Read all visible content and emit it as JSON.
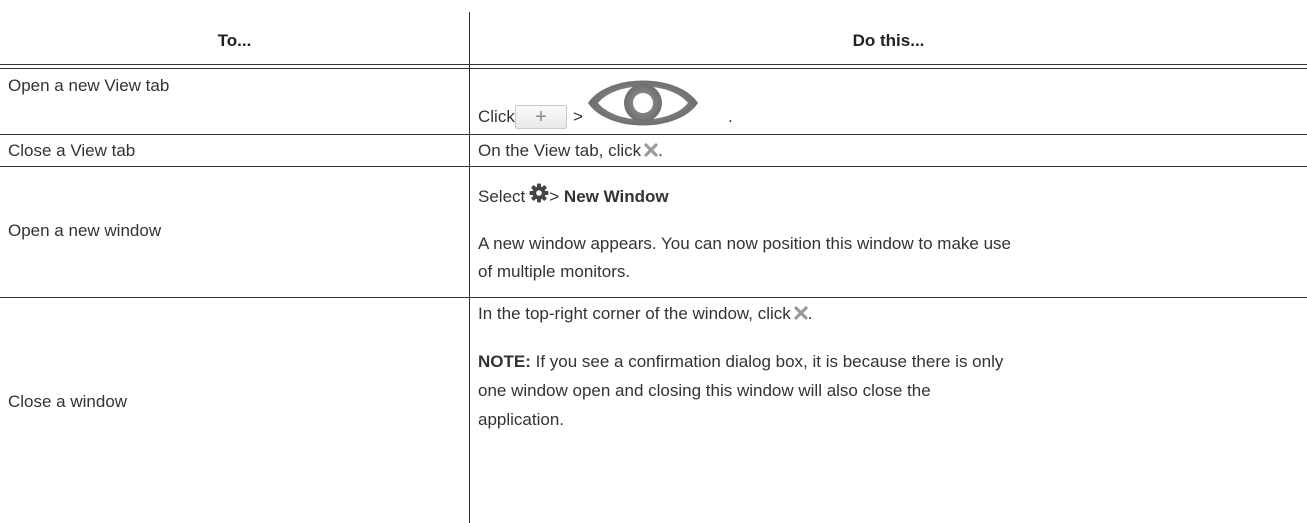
{
  "header": {
    "col1": "To...",
    "col2": "Do this..."
  },
  "rows": [
    {
      "action": "Open a new View tab",
      "click_label": "Click",
      "separator": ">",
      "plus_glyph": "+",
      "end": ".",
      "icons": [
        "plus-button-icon",
        "eye-icon"
      ]
    },
    {
      "action": "Close a View tab",
      "text": "On the View tab, click",
      "end": ".",
      "icons": [
        "close-x-icon"
      ]
    },
    {
      "action": "Open a new window",
      "select_label": "Select",
      "separator": ">",
      "menu_item": "New Window",
      "para_line1": "A new window appears. You can now position this window to make use",
      "para_line2": "of multiple monitors.",
      "icons": [
        "gear-icon"
      ]
    },
    {
      "action": "Close a window",
      "text": "In the top-right corner of the window, click",
      "end": ".",
      "note_label": "NOTE:",
      "note_line1": " If you see a confirmation dialog box, it is because there is only",
      "note_line2": "one window open and closing this window will also close the",
      "note_line3": "application.",
      "icons": [
        "close-x-icon"
      ]
    }
  ],
  "colors": {
    "text": "#333333",
    "rule": "#333333",
    "icon_grey": "#9a9a9a",
    "gear": "#444444"
  }
}
